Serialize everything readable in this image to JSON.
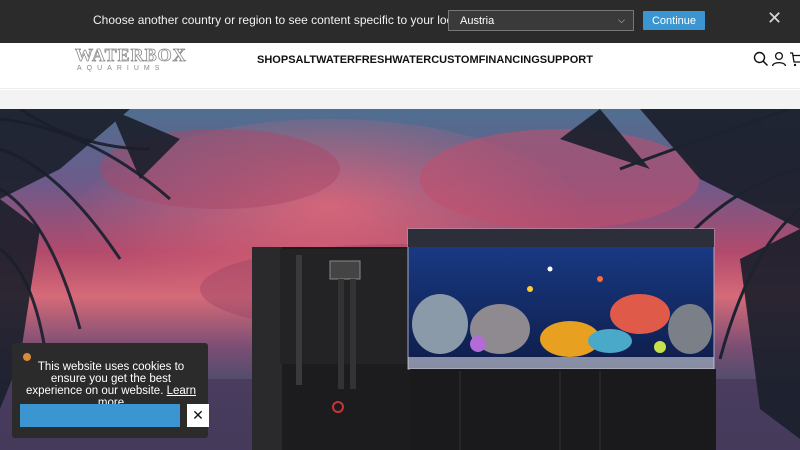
{
  "country_banner": {
    "message": "Choose another country or region to see content specific to your location.",
    "selected_country": "Austria",
    "continue_label": "Continue",
    "close_glyph": "✕"
  },
  "header": {
    "logo_text": "WATERBOX",
    "logo_subtext": "AQUARIUMS",
    "nav": [
      "SHOP",
      "SALTWATER",
      "FRESHWATER",
      "CUSTOM",
      "FINANCING",
      "SUPPORT"
    ],
    "icons": [
      "search-icon",
      "account-icon",
      "cart-icon"
    ]
  },
  "cookie": {
    "text": "This website uses cookies to ensure you get the best experience on our website.",
    "link_text": "Learn more",
    "close_glyph": "✕"
  },
  "colors": {
    "banner_bg": "#2b2b2b",
    "accent_blue": "#3b95d1",
    "pill_blue": "#2f7fd1"
  }
}
